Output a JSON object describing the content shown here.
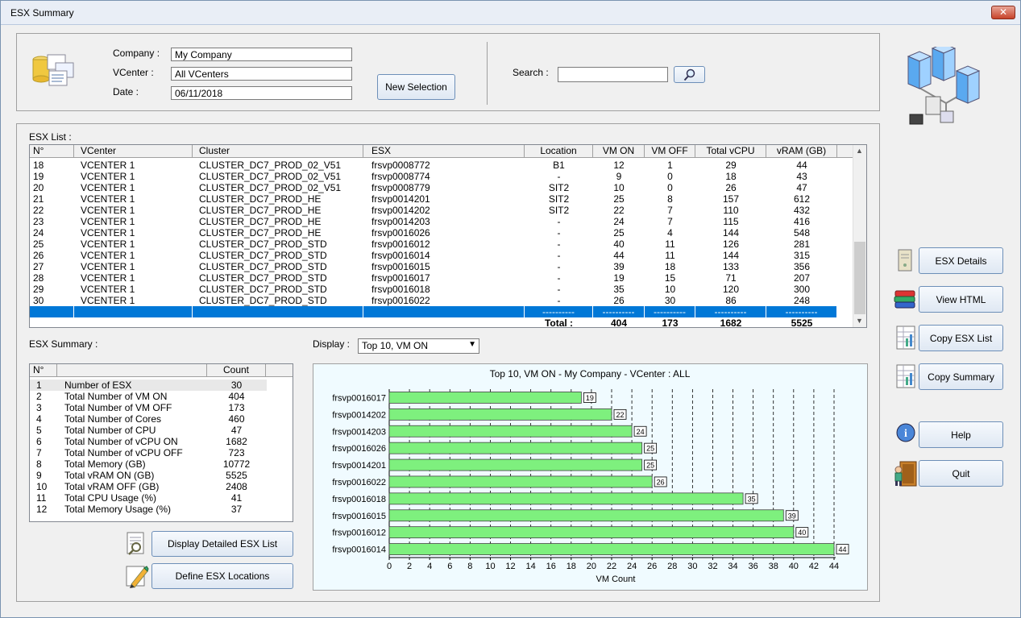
{
  "window": {
    "title": "ESX Summary",
    "close_glyph": "✕"
  },
  "header": {
    "company_label": "Company :",
    "company_value": "My Company",
    "vcenter_label": "VCenter :",
    "vcenter_value": "All VCenters",
    "date_label": "Date :",
    "date_value": "06/11/2018",
    "new_selection": "New Selection",
    "search_label": "Search :",
    "search_value": ""
  },
  "esx_list": {
    "title": "ESX List :",
    "columns": [
      "N°",
      "VCenter",
      "Cluster",
      "ESX",
      "Location",
      "VM ON",
      "VM OFF",
      "Total vCPU",
      "vRAM (GB)"
    ],
    "rows": [
      [
        "18",
        "VCENTER 1",
        "CLUSTER_DC7_PROD_02_V51",
        "frsvp0008772",
        "B1",
        "12",
        "1",
        "29",
        "44"
      ],
      [
        "19",
        "VCENTER 1",
        "CLUSTER_DC7_PROD_02_V51",
        "frsvp0008774",
        "-",
        "9",
        "0",
        "18",
        "43"
      ],
      [
        "20",
        "VCENTER 1",
        "CLUSTER_DC7_PROD_02_V51",
        "frsvp0008779",
        "SIT2",
        "10",
        "0",
        "26",
        "47"
      ],
      [
        "21",
        "VCENTER 1",
        "CLUSTER_DC7_PROD_HE",
        "frsvp0014201",
        "SIT2",
        "25",
        "8",
        "157",
        "612"
      ],
      [
        "22",
        "VCENTER 1",
        "CLUSTER_DC7_PROD_HE",
        "frsvp0014202",
        "SIT2",
        "22",
        "7",
        "110",
        "432"
      ],
      [
        "23",
        "VCENTER 1",
        "CLUSTER_DC7_PROD_HE",
        "frsvp0014203",
        "-",
        "24",
        "7",
        "115",
        "416"
      ],
      [
        "24",
        "VCENTER 1",
        "CLUSTER_DC7_PROD_HE",
        "frsvp0016026",
        "-",
        "25",
        "4",
        "144",
        "548"
      ],
      [
        "25",
        "VCENTER 1",
        "CLUSTER_DC7_PROD_STD",
        "frsvp0016012",
        "-",
        "40",
        "11",
        "126",
        "281"
      ],
      [
        "26",
        "VCENTER 1",
        "CLUSTER_DC7_PROD_STD",
        "frsvp0016014",
        "-",
        "44",
        "11",
        "144",
        "315"
      ],
      [
        "27",
        "VCENTER 1",
        "CLUSTER_DC7_PROD_STD",
        "frsvp0016015",
        "-",
        "39",
        "18",
        "133",
        "356"
      ],
      [
        "28",
        "VCENTER 1",
        "CLUSTER_DC7_PROD_STD",
        "frsvp0016017",
        "-",
        "19",
        "15",
        "71",
        "207"
      ],
      [
        "29",
        "VCENTER 1",
        "CLUSTER_DC7_PROD_STD",
        "frsvp0016018",
        "-",
        "35",
        "10",
        "120",
        "300"
      ],
      [
        "30",
        "VCENTER 1",
        "CLUSTER_DC7_PROD_STD",
        "frsvp0016022",
        "-",
        "26",
        "30",
        "86",
        "248"
      ]
    ],
    "separator": [
      "",
      "",
      "",
      "",
      "----------",
      "----------",
      "----------",
      "----------",
      "----------"
    ],
    "total": [
      "",
      "",
      "",
      "",
      "Total :",
      "404",
      "173",
      "1682",
      "5525"
    ],
    "scroll_up": "▲",
    "scroll_down": "▼"
  },
  "summary": {
    "title": "ESX Summary :",
    "columns": [
      "N°",
      "",
      "Count"
    ],
    "rows": [
      [
        "1",
        "Number of ESX",
        "30"
      ],
      [
        "2",
        "Total Number of VM ON",
        "404"
      ],
      [
        "3",
        "Total Number of VM OFF",
        "173"
      ],
      [
        "4",
        "Total Number of Cores",
        "460"
      ],
      [
        "5",
        "Total Number of CPU",
        "47"
      ],
      [
        "6",
        "Total Number of vCPU ON",
        "1682"
      ],
      [
        "7",
        "Total Number of vCPU OFF",
        "723"
      ],
      [
        "8",
        "Total Memory (GB)",
        "10772"
      ],
      [
        "9",
        "Total vRAM ON (GB)",
        "5525"
      ],
      [
        "10",
        "Total vRAM OFF (GB)",
        "2408"
      ],
      [
        "11",
        "Total CPU Usage (%)",
        "41"
      ],
      [
        "12",
        "Total Memory Usage (%)",
        "37"
      ]
    ],
    "display_detailed": "Display Detailed ESX List",
    "define_locations": "Define ESX Locations"
  },
  "display": {
    "label": "Display :",
    "selected": "Top 10, VM ON"
  },
  "side_buttons": {
    "esx_details": "ESX Details",
    "view_html": "View HTML",
    "copy_esx_list": "Copy ESX List",
    "copy_summary": "Copy Summary",
    "help": "Help",
    "quit": "Quit"
  },
  "icons": {
    "database": "database-icon",
    "servers": "servers-network-icon",
    "search": "magnifier-icon"
  },
  "colors": {
    "bar": "#7ef07e",
    "selection": "#0078d7",
    "chart_bg": "#f0fbff"
  },
  "chart_data": {
    "type": "bar",
    "orientation": "horizontal",
    "title": "Top 10, VM ON - My Company - VCenter : ALL",
    "xlabel": "VM Count",
    "ylabel": "",
    "categories": [
      "frsvp0016017",
      "frsvp0014202",
      "frsvp0014203",
      "frsvp0016026",
      "frsvp0014201",
      "frsvp0016022",
      "frsvp0016018",
      "frsvp0016015",
      "frsvp0016012",
      "frsvp0016014"
    ],
    "values": [
      19,
      22,
      24,
      25,
      25,
      26,
      35,
      39,
      40,
      44
    ],
    "xlim": [
      0,
      44
    ],
    "xticks": [
      0,
      2,
      4,
      6,
      8,
      10,
      12,
      14,
      16,
      18,
      20,
      22,
      24,
      26,
      28,
      30,
      32,
      34,
      36,
      38,
      40,
      42,
      44
    ],
    "grid": "vertical dashed"
  }
}
